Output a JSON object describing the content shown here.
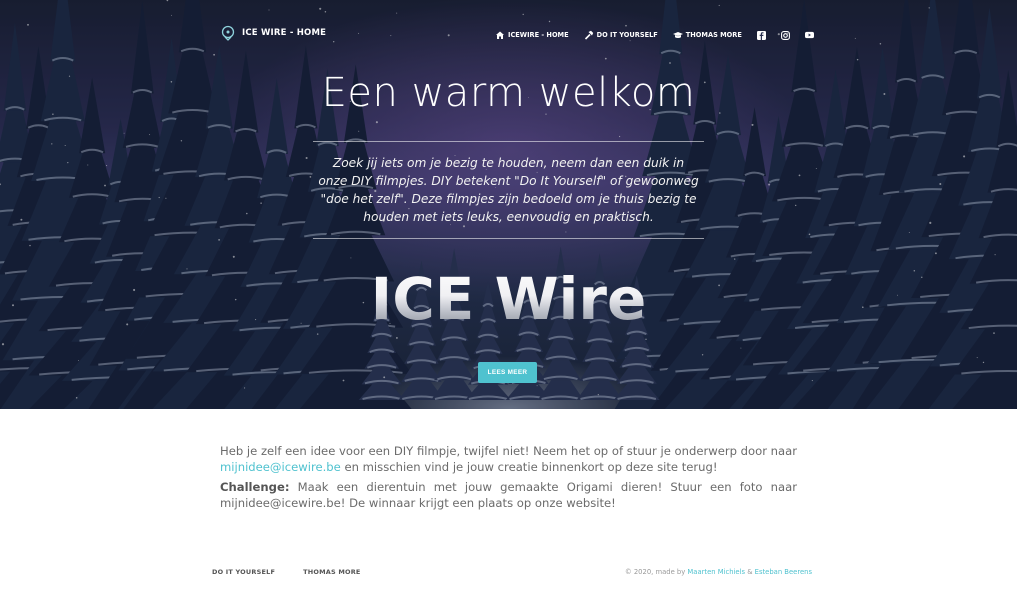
{
  "brand": {
    "title": "ICE WIRE - HOME",
    "logo_icon": "ice-wire-logo-icon"
  },
  "nav": {
    "items": [
      {
        "label": "ICEWIRE - HOME",
        "icon": "home-icon"
      },
      {
        "label": "DO IT YOURSELF",
        "icon": "hammer-icon"
      },
      {
        "label": "THOMAS MORE",
        "icon": "graduation-cap-icon"
      }
    ],
    "social": [
      "facebook-icon",
      "instagram-icon",
      "youtube-icon"
    ]
  },
  "hero": {
    "heading": "Een warm welkom",
    "intro": "Zoek jij iets om je bezig te houden, neem dan een duik in onze DIY filmpjes. DIY betekent \"Do It Yourself\" of gewoonweg \"doe het zelf\". Deze filmpjes zijn bedoeld om je thuis bezig te houden met iets leuks, eenvoudig en praktisch.",
    "big_title": "ICE Wire",
    "button_label": "LEES MEER"
  },
  "content": {
    "p1_text": "Heb je zelf een idee voor een DIY filmpje, twijfel niet! Neem het op of stuur je onderwerp door naar ",
    "p1_link": "mijnidee@icewire.be",
    "p1_rest": " en misschien vind je jouw creatie binnenkort op deze site terug!",
    "p2_label": "Challenge:",
    "p2_text": " Maak een dierentuin met jouw gemaakte Origami dieren! Stuur een foto naar mijnidee@icewire.be! De winnaar krijgt een plaats op onze website!"
  },
  "footer": {
    "links": [
      "DO IT YOURSELF",
      "THOMAS MORE"
    ],
    "copyright_prefix": "© 2020, made by ",
    "author1": "Maarten Michiels",
    "separator": " & ",
    "author2": "Esteban Beerens"
  },
  "colors": {
    "accent": "#4fc2cf",
    "text": "#6b6b6b",
    "hero_dark": "#1a2035"
  }
}
